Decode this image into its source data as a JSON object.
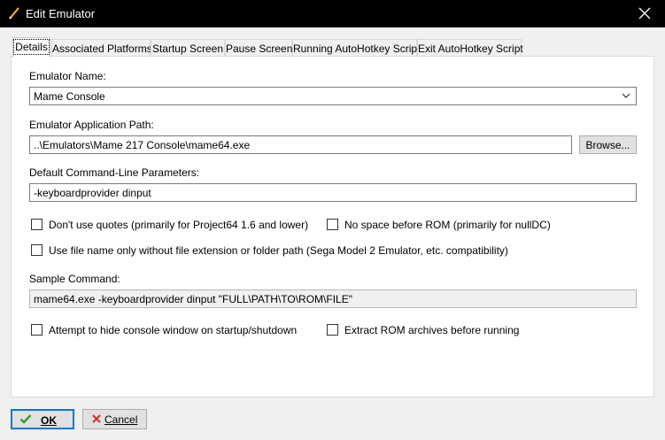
{
  "window": {
    "title": "Edit Emulator"
  },
  "tabs": [
    {
      "label": "Details",
      "active": true
    },
    {
      "label": "Associated Platforms"
    },
    {
      "label": "Startup Screen"
    },
    {
      "label": "Pause Screen"
    },
    {
      "label": "Running AutoHotkey Script"
    },
    {
      "label": "Exit AutoHotkey Script"
    }
  ],
  "form": {
    "name_label": "Emulator Name:",
    "name_value": "Mame Console",
    "path_label": "Emulator Application Path:",
    "path_value": "..\\Emulators\\Mame 217 Console\\mame64.exe",
    "browse_label": "Browse...",
    "params_label": "Default Command-Line Parameters:",
    "params_value": "-keyboardprovider dinput",
    "checks": {
      "no_quotes": {
        "label": "Don't use quotes (primarily for Project64 1.6 and lower)",
        "checked": false
      },
      "no_space": {
        "label": "No space before ROM (primarily for nullDC)",
        "checked": false
      },
      "filename_only": {
        "label": "Use file name only without file extension or folder path (Sega Model 2 Emulator, etc. compatibility)",
        "checked": false
      },
      "hide_console": {
        "label": "Attempt to hide console window on startup/shutdown",
        "checked": false
      },
      "extract_rom": {
        "label": "Extract ROM archives before running",
        "checked": false
      }
    },
    "sample_label": "Sample Command:",
    "sample_value": "mame64.exe -keyboardprovider dinput \"FULL\\PATH\\TO\\ROM\\FILE\""
  },
  "footer": {
    "ok_label": "OK",
    "cancel_label": "Cancel"
  },
  "colors": {
    "titlebar": "#000000",
    "accent": "#0078d7",
    "ok_check": "#2e9e2e",
    "cancel_x": "#d03030"
  }
}
